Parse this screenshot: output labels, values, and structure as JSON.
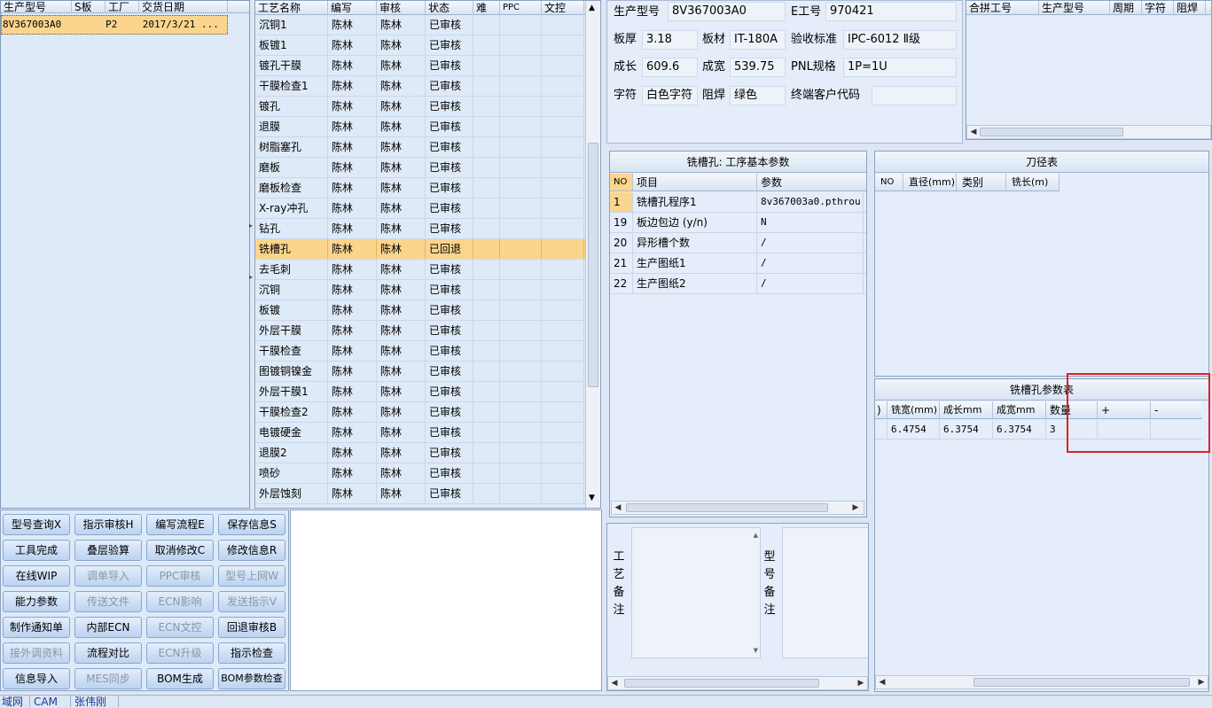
{
  "left_list": {
    "headers": [
      "生产型号",
      "S板",
      "工厂",
      "交货日期"
    ],
    "rows": [
      [
        "8V367003A0",
        "",
        "P2",
        "2017/3/21 ..."
      ]
    ]
  },
  "process_grid": {
    "headers": [
      "工艺名称",
      "编写",
      "审核",
      "状态",
      "难",
      "PPC",
      "文控"
    ],
    "rows": [
      [
        "沉铜1",
        "陈林",
        "陈林",
        "已审核"
      ],
      [
        "板镀1",
        "陈林",
        "陈林",
        "已审核"
      ],
      [
        "镀孔干膜",
        "陈林",
        "陈林",
        "已审核"
      ],
      [
        "干膜检查1",
        "陈林",
        "陈林",
        "已审核"
      ],
      [
        "镀孔",
        "陈林",
        "陈林",
        "已审核"
      ],
      [
        "退膜",
        "陈林",
        "陈林",
        "已审核"
      ],
      [
        "树脂塞孔",
        "陈林",
        "陈林",
        "已审核"
      ],
      [
        "磨板",
        "陈林",
        "陈林",
        "已审核"
      ],
      [
        "磨板检查",
        "陈林",
        "陈林",
        "已审核"
      ],
      [
        "X-ray冲孔",
        "陈林",
        "陈林",
        "已审核"
      ],
      [
        "钻孔",
        "陈林",
        "陈林",
        "已审核"
      ],
      [
        "铣槽孔",
        "陈林",
        "陈林",
        "已回退"
      ],
      [
        "去毛刺",
        "陈林",
        "陈林",
        "已审核"
      ],
      [
        "沉铜",
        "陈林",
        "陈林",
        "已审核"
      ],
      [
        "板镀",
        "陈林",
        "陈林",
        "已审核"
      ],
      [
        "外层干膜",
        "陈林",
        "陈林",
        "已审核"
      ],
      [
        "干膜检查",
        "陈林",
        "陈林",
        "已审核"
      ],
      [
        "图镀铜镍金",
        "陈林",
        "陈林",
        "已审核"
      ],
      [
        "外层干膜1",
        "陈林",
        "陈林",
        "已审核"
      ],
      [
        "干膜检查2",
        "陈林",
        "陈林",
        "已审核"
      ],
      [
        "电镀硬金",
        "陈林",
        "陈林",
        "已审核"
      ],
      [
        "退膜2",
        "陈林",
        "陈林",
        "已审核"
      ],
      [
        "喷砂",
        "陈林",
        "陈林",
        "已审核"
      ],
      [
        "外层蚀刻",
        "陈林",
        "陈林",
        "已审核"
      ]
    ]
  },
  "buttons": [
    [
      "型号查询X",
      "指示审核H",
      "编写流程E",
      "保存信息S"
    ],
    [
      "工具完成",
      "叠层验算",
      "取消修改C",
      "修改信息R"
    ],
    [
      "在线WIP",
      "调单导入",
      "PPC审核",
      "型号上网W"
    ],
    [
      "能力参数",
      "传送文件",
      "ECN影响",
      "发送指示V"
    ],
    [
      "制作通知单",
      "内部ECN",
      "ECN文控",
      "回退审核B"
    ],
    [
      "接外调资料",
      "流程对比",
      "ECN升级",
      "指示检查"
    ],
    [
      "信息导入",
      "MES同步",
      "BOM生成",
      "BOM参数检查"
    ]
  ],
  "info": {
    "model_label": "生产型号",
    "model_value": "8V367003A0",
    "e_label": "E工号",
    "e_value": "970421",
    "thick_label": "板厚",
    "thick_value": "3.18",
    "mat_label": "板材",
    "mat_value": "IT-180A",
    "std_label": "验收标准",
    "std_value": "IPC-6012 Ⅱ级",
    "len_label": "成长",
    "len_value": "609.6",
    "wid_label": "成宽",
    "wid_value": "539.75",
    "pnl_label": "PNL规格",
    "pnl_value": "1P=1U",
    "char_label": "字符",
    "char_value": "白色字符",
    "mask_label": "阻焊",
    "mask_value": "绿色",
    "cust_label": "终端客户代码",
    "cust_value": ""
  },
  "merge_table": {
    "headers": [
      "合拼工号",
      "生产型号",
      "周期",
      "字符",
      "阻焊"
    ]
  },
  "params": {
    "title": "铣槽孔: 工序基本参数",
    "headers": [
      "NO",
      "项目",
      "参数"
    ],
    "rows": [
      [
        "1",
        "铣槽孔程序1",
        "8v367003a0.pthrou"
      ],
      [
        "19",
        "板边包边 (y/n)",
        "N"
      ],
      [
        "20",
        "异形槽个数",
        "/"
      ],
      [
        "21",
        "生产图纸1",
        "/"
      ],
      [
        "22",
        "生产图纸2",
        "/"
      ]
    ]
  },
  "tools": {
    "title": "刀径表",
    "headers": [
      "NO",
      "直径(mm)",
      "类别",
      "铣长(m)"
    ]
  },
  "slot_params": {
    "title": "铣槽孔参数表",
    "headers": [
      ")",
      "铣宽(mm)",
      "成长mm",
      "成宽mm",
      "数量",
      "+",
      "-"
    ],
    "row": [
      "",
      "6.4754",
      "6.3754",
      "6.3754",
      "3",
      "",
      ""
    ]
  },
  "remarks": {
    "process_label": "工艺备注",
    "model_label": "型号备注"
  },
  "status_bar": [
    "域网",
    "CAM",
    "张伟刚"
  ],
  "colors": {
    "selected_row": "#fbd58e",
    "highlight_box": "#e02020"
  }
}
